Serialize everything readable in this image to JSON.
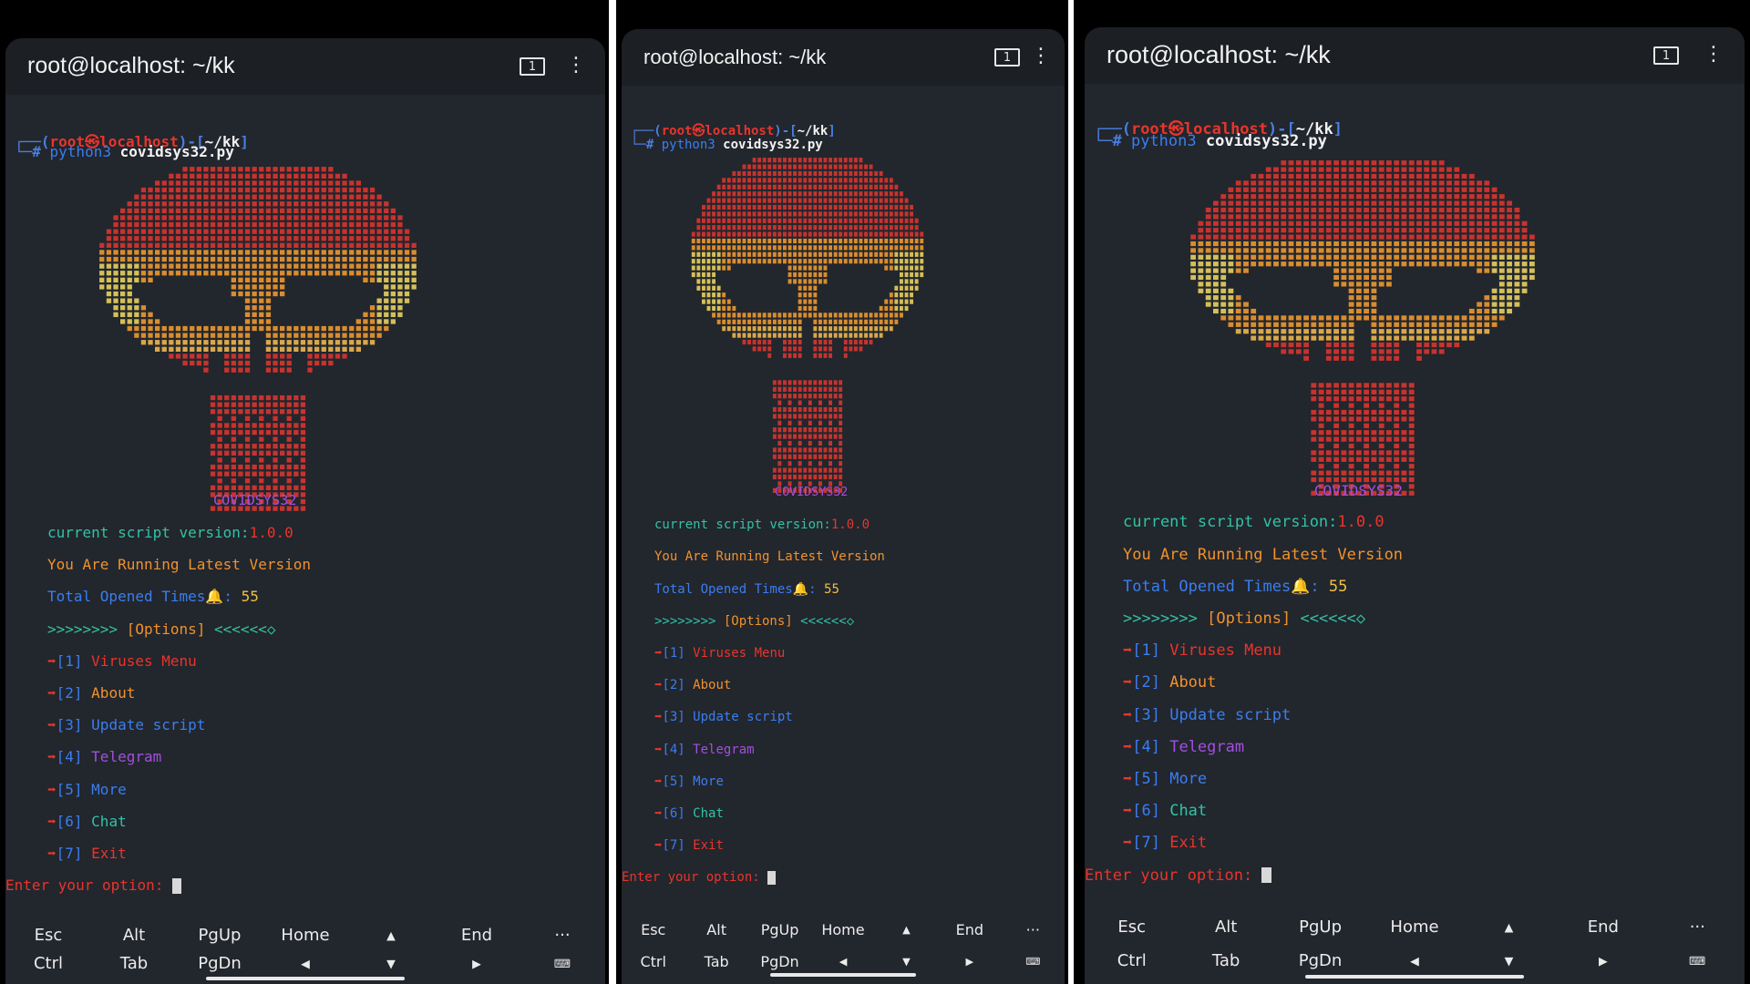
{
  "window_title": "root@localhost: ~/kk",
  "tab_count": "1",
  "menu_glyph": "⋮",
  "prompt": {
    "open": "┌──(",
    "user_host": "root㉿localhost",
    "sep": ")-[",
    "path": "~/kk",
    "close": "]",
    "hash": "└─# ",
    "command_prog": "python3 ",
    "command_file": "covidsys32.py"
  },
  "banner_name": "COVIDSYS32",
  "version_label": "current script version:",
  "version_value": "1.0.0",
  "status_line": "You Are Running Latest Version",
  "opened_label": "Total Opened Times🔔: ",
  "opened_value": "55",
  "options_left": ">>>>>>>> ",
  "options_label": "[Options]",
  "options_right": " <<<<<<◇",
  "menu": [
    {
      "num": "[1] ",
      "label": "Viruses Menu",
      "color": "#e8352c"
    },
    {
      "num": "[2] ",
      "label": "About",
      "color": "#f0922c"
    },
    {
      "num": "[3] ",
      "label": "Update script",
      "color": "#3a7ef0"
    },
    {
      "num": "[4] ",
      "label": "Telegram",
      "color": "#a24fe0"
    },
    {
      "num": "[5] ",
      "label": "More",
      "color": "#3a7ef0"
    },
    {
      "num": "[6] ",
      "label": "Chat",
      "color": "#32c2a4"
    },
    {
      "num": "[7] ",
      "label": "Exit",
      "color": "#e8352c"
    }
  ],
  "arrow": "➡",
  "input_prompt": "Enter your option: ",
  "extra_keys": {
    "row1": [
      "Esc",
      "Alt",
      "PgUp",
      "Home",
      "▲",
      "End",
      "···"
    ],
    "row2": [
      "Ctrl",
      "Tab",
      "PgDn",
      "◀",
      "▼",
      "▶",
      "⌨"
    ]
  },
  "colors": {
    "terminal_bg": "#22262d",
    "red": "#e8352c",
    "orange": "#f0922c",
    "teal": "#32c2a4",
    "blue": "#3a7ef0",
    "purple": "#a24fe0",
    "white": "#f2f2f2"
  }
}
